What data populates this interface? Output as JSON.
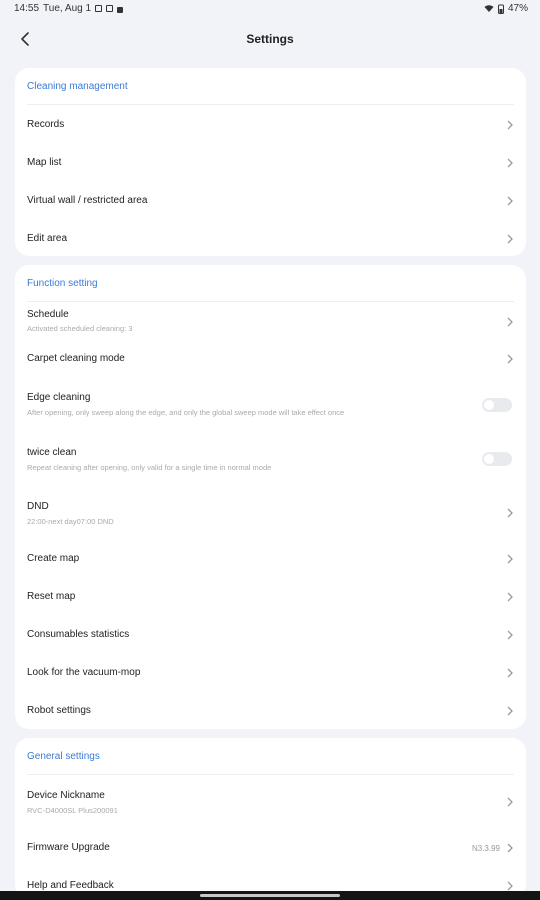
{
  "status": {
    "time": "14:55",
    "date": "Tue, Aug 1",
    "battery": "47%"
  },
  "header": {
    "title": "Settings"
  },
  "cleaning_management": {
    "title": "Cleaning management",
    "items": [
      {
        "label": "Records"
      },
      {
        "label": "Map list"
      },
      {
        "label": "Virtual wall / restricted area"
      },
      {
        "label": "Edit area"
      }
    ]
  },
  "function_setting": {
    "title": "Function setting",
    "schedule": {
      "label": "Schedule",
      "sub": "Activated scheduled cleaning: 3"
    },
    "carpet": {
      "label": "Carpet cleaning mode"
    },
    "edge": {
      "label": "Edge cleaning",
      "sub": "After opening, only sweep along the edge, and only the global sweep mode will take effect once",
      "on": false
    },
    "twice": {
      "label": "twice clean",
      "sub": "Repeat cleaning after opening, only valid for a single time in normal mode",
      "on": false
    },
    "dnd": {
      "label": "DND",
      "sub": "22:00-next day07:00 DND"
    },
    "create_map": {
      "label": "Create map"
    },
    "reset_map": {
      "label": "Reset map"
    },
    "consumables": {
      "label": "Consumables statistics"
    },
    "look": {
      "label": "Look for the vacuum-mop"
    },
    "robot": {
      "label": "Robot settings"
    }
  },
  "general_settings": {
    "title": "General settings",
    "nickname": {
      "label": "Device Nickname",
      "sub": "RVC-D4000SL Plus200091"
    },
    "firmware": {
      "label": "Firmware Upgrade",
      "value": "N3.3.99"
    },
    "help": {
      "label": "Help and Feedback"
    }
  },
  "colors": {
    "accent": "#3b7bd6",
    "background": "#f1f3f8",
    "card": "#ffffff"
  }
}
